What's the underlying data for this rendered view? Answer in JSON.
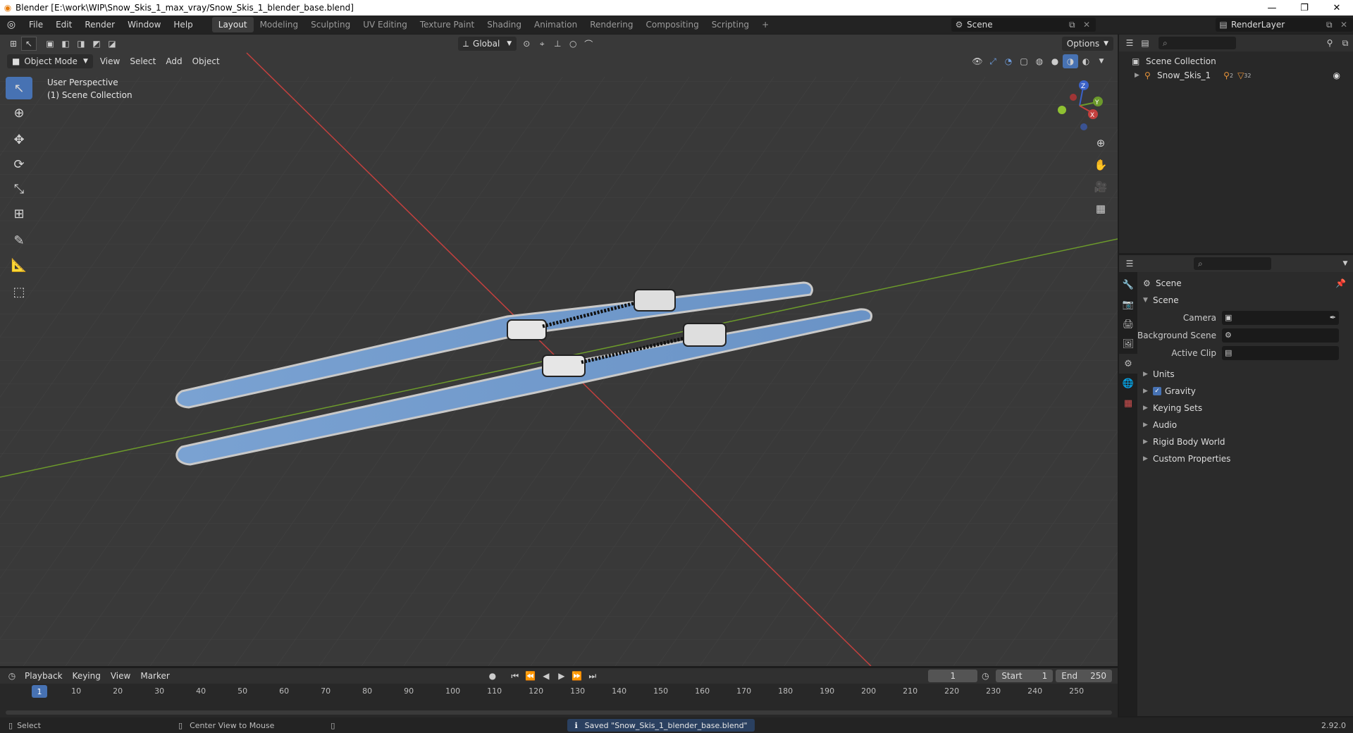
{
  "window": {
    "title": "Blender [E:\\work\\WIP\\Snow_Skis_1_max_vray/Snow_Skis_1_blender_base.blend]",
    "minimize": "—",
    "restore": "❐",
    "close": "✕"
  },
  "menu": [
    "File",
    "Edit",
    "Render",
    "Window",
    "Help"
  ],
  "workspaces": [
    "Layout",
    "Modeling",
    "Sculpting",
    "UV Editing",
    "Texture Paint",
    "Shading",
    "Animation",
    "Rendering",
    "Compositing",
    "Scripting"
  ],
  "active_workspace": "Layout",
  "add_workspace": "+",
  "scene_name": "Scene",
  "render_layer": "RenderLayer",
  "viewport": {
    "transform_orientation": "Global",
    "options_label": "Options",
    "mode": "Object Mode",
    "header_menus": [
      "View",
      "Select",
      "Add",
      "Object"
    ],
    "info_line1": "User Perspective",
    "info_line2": "(1) Scene Collection",
    "gizmo_axes": {
      "z": "Z",
      "y": "Y",
      "x": "X"
    }
  },
  "outliner": {
    "collection": "Scene Collection",
    "object": "Snow_Skis_1",
    "object_badge_1": "2",
    "object_badge_2": "32"
  },
  "properties": {
    "context": "Scene",
    "section": "Scene",
    "fields": [
      {
        "label": "Camera",
        "value": ""
      },
      {
        "label": "Background Scene",
        "value": ""
      },
      {
        "label": "Active Clip",
        "value": ""
      }
    ],
    "subsections": [
      "Units",
      "Gravity",
      "Keying Sets",
      "Audio",
      "Rigid Body World",
      "Custom Properties"
    ],
    "gravity_checked": true
  },
  "timeline": {
    "menus": [
      "Playback",
      "Keying",
      "View",
      "Marker"
    ],
    "current_frame": "1",
    "start_label": "Start",
    "start": "1",
    "end_label": "End",
    "end": "250",
    "ticks": [
      "10",
      "20",
      "30",
      "40",
      "50",
      "60",
      "70",
      "80",
      "90",
      "100",
      "110",
      "120",
      "130",
      "140",
      "150",
      "160",
      "170",
      "180",
      "190",
      "200",
      "210",
      "220",
      "230",
      "240",
      "250"
    ]
  },
  "status": {
    "left_action": "Select",
    "mid_action": "Center View to Mouse",
    "message": "Saved \"Snow_Skis_1_blender_base.blend\"",
    "version": "2.92.0"
  },
  "colors": {
    "accent": "#4772b3",
    "viewport_bg": "#393939",
    "x_axis": "#c4403e",
    "y_axis": "#6c9a2b",
    "ski_blue": "#6f98c8"
  }
}
